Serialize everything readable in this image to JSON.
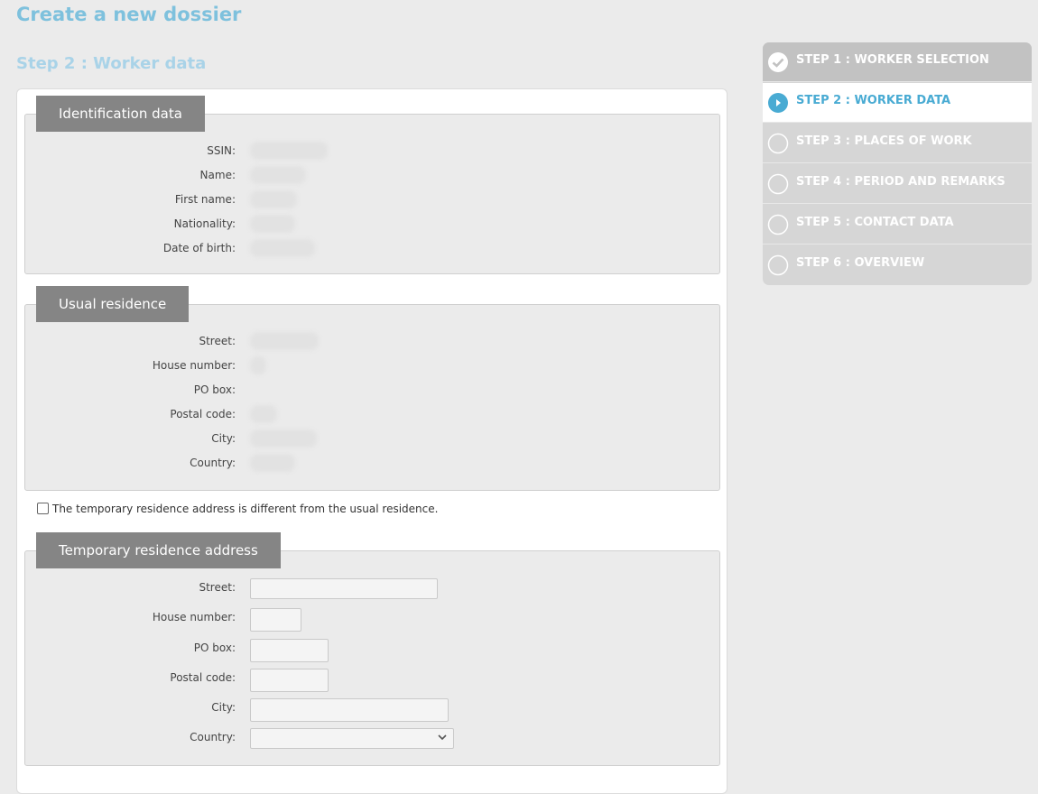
{
  "page": {
    "title": "Create a new dossier",
    "step_title": "Step 2 : Worker data"
  },
  "identification": {
    "legend": "Identification data",
    "fields": [
      {
        "label": "SSIN:",
        "value": ""
      },
      {
        "label": "Name:",
        "value": ""
      },
      {
        "label": "First name:",
        "value": ""
      },
      {
        "label": "Nationality:",
        "value": ""
      },
      {
        "label": "Date of birth:",
        "value": ""
      }
    ]
  },
  "usual_residence": {
    "legend": "Usual residence",
    "fields": [
      {
        "label": "Street:",
        "value": ""
      },
      {
        "label": "House number:",
        "value": ""
      },
      {
        "label": "PO box:",
        "value": ""
      },
      {
        "label": "Postal code:",
        "value": ""
      },
      {
        "label": "City:",
        "value": ""
      },
      {
        "label": "Country:",
        "value": ""
      }
    ]
  },
  "temporary_checkbox": {
    "label": "The temporary residence address is different from the usual residence.",
    "checked": false
  },
  "temporary_residence": {
    "legend": "Temporary residence address",
    "fields": [
      {
        "label": "Street:",
        "value": ""
      },
      {
        "label": "House number:",
        "value": ""
      },
      {
        "label": "PO box:",
        "value": ""
      },
      {
        "label": "Postal code:",
        "value": ""
      },
      {
        "label": "City:",
        "value": ""
      },
      {
        "label": "Country:",
        "value": ""
      }
    ]
  },
  "steps": [
    {
      "label": "STEP 1 : WORKER SELECTION",
      "state": "done",
      "icon": "check-circle-icon"
    },
    {
      "label": "STEP 2 : WORKER DATA",
      "state": "active",
      "icon": "play-circle-icon"
    },
    {
      "label": "STEP 3 : PLACES OF WORK",
      "state": "pending",
      "icon": "empty-circle-icon"
    },
    {
      "label": "STEP 4 : PERIOD AND REMARKS",
      "state": "pending",
      "icon": "empty-circle-icon"
    },
    {
      "label": "STEP 5 : CONTACT DATA",
      "state": "pending",
      "icon": "empty-circle-icon"
    },
    {
      "label": "STEP 6 : OVERVIEW",
      "state": "pending",
      "icon": "empty-circle-icon"
    }
  ],
  "colors": {
    "title": "#7ec1dd",
    "step_title": "#a9d3e8",
    "legend_bg": "#858585",
    "active_step": "#49abd3"
  }
}
